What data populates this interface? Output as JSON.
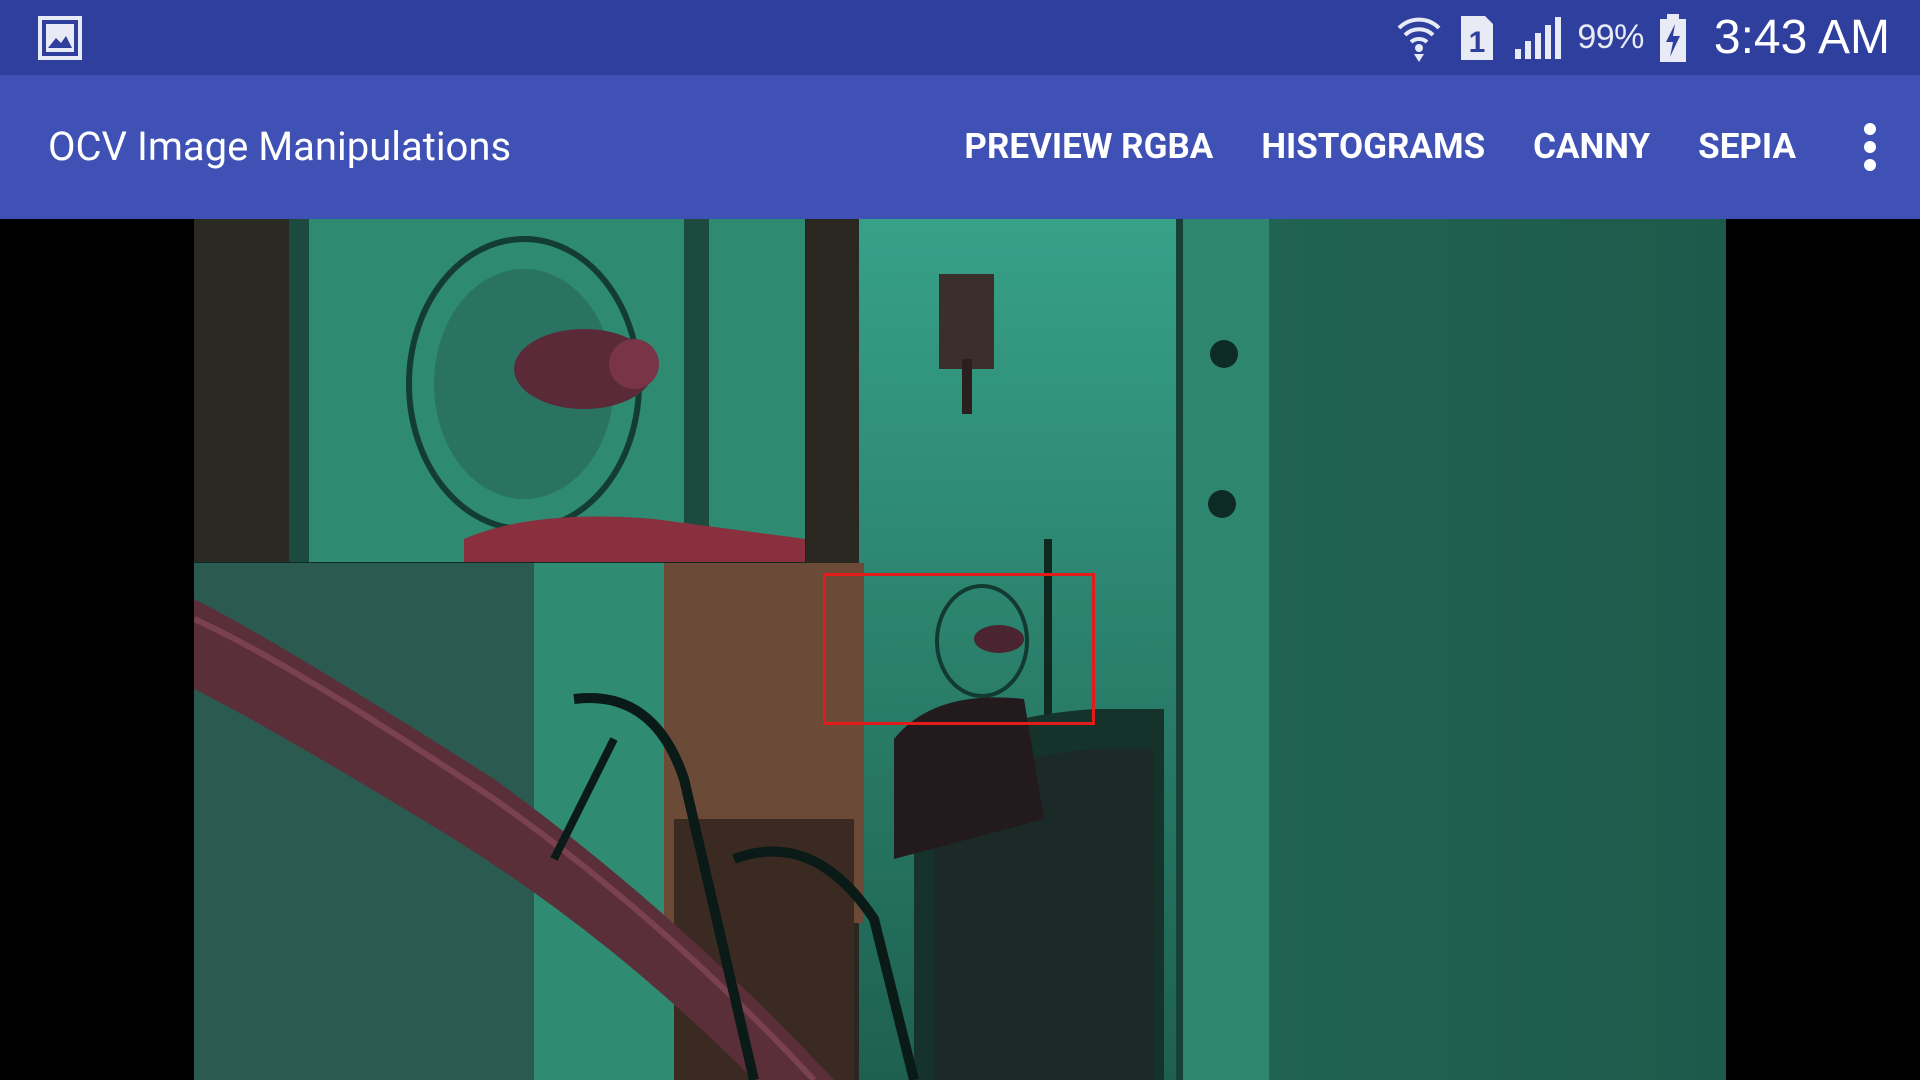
{
  "status_bar": {
    "left_icon": "gallery-image-icon",
    "wifi_icon": "wifi-icon",
    "sim_icon": "sim-1-icon",
    "sim_label": "1",
    "signal_icon": "cell-signal-icon",
    "battery_percent": "99%",
    "battery_icon": "battery-charging-icon",
    "time": "3:43 AM"
  },
  "action_bar": {
    "title": "OCV Image Manipulations",
    "actions": [
      {
        "label": "PREVIEW RGBA"
      },
      {
        "label": "HISTOGRAMS"
      },
      {
        "label": "CANNY"
      },
      {
        "label": "SEPIA"
      }
    ],
    "overflow_icon": "more-vert-icon"
  },
  "preview": {
    "description_icon": "camera-preview",
    "roi_color": "#e21b1b"
  },
  "colors": {
    "status_bar": "#2f3f9e",
    "action_bar": "#3f51b5",
    "letterbox": "#000000",
    "wall_teal": "#2a7a64"
  }
}
